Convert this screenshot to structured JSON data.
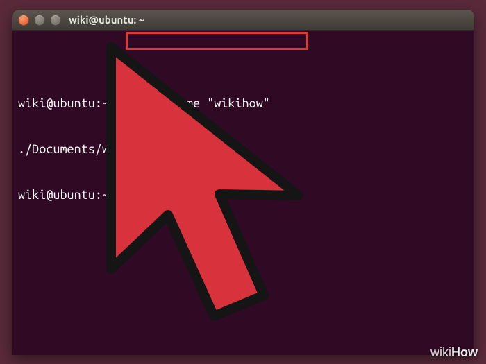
{
  "window": {
    "title": "wiki@ubuntu: ~"
  },
  "terminal": {
    "prompt": "wiki@ubuntu:~$",
    "lines": [
      {
        "prompt": "wiki@ubuntu:~$",
        "after_prompt": " ",
        "cmd": "find -iname \"wikihow\""
      },
      {
        "text": "./Documents/wikihow"
      },
      {
        "prompt": "wiki@ubuntu:~$",
        "after_prompt": " ",
        "cursor": true
      }
    ]
  },
  "watermark": {
    "light": "wiki",
    "bold": "How"
  },
  "colors": {
    "terminal_bg": "#300a24",
    "highlight_border": "#e03a35",
    "cursor_fill": "#d8333d",
    "cursor_stroke": "#151515"
  }
}
